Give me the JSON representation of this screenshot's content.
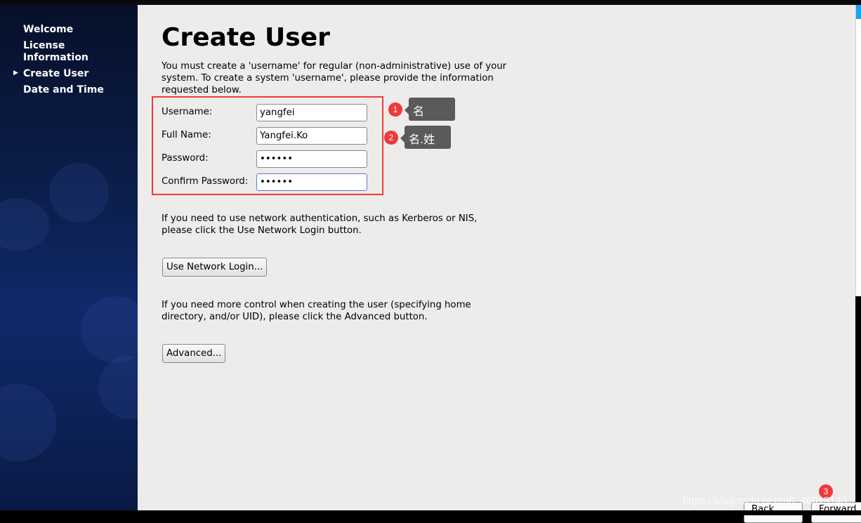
{
  "sidebar": {
    "items": [
      {
        "label": "Welcome"
      },
      {
        "label": "License Information"
      },
      {
        "label": "Create User",
        "current": true
      },
      {
        "label": "Date and Time"
      }
    ]
  },
  "main": {
    "title": "Create User",
    "intro": "You must create a 'username' for regular (non-administrative) use of your system.  To create a system 'username', please provide the information requested below.",
    "fields": [
      {
        "label": "Username:",
        "value": "yangfei"
      },
      {
        "label": "Full Name:",
        "value": "Yangfei.Ko"
      },
      {
        "label": "Password:",
        "value": "••••••"
      },
      {
        "label": "Confirm Password:",
        "value": "••••••"
      }
    ],
    "network_text": "If you need to use network authentication, such as Kerberos or NIS, please click the Use Network Login button.",
    "network_button": "Use Network Login...",
    "advanced_text": "If you need more control when creating the user (specifying home directory, and/or UID), please click the Advanced button.",
    "advanced_button": "Advanced..."
  },
  "annotations": [
    {
      "num": "1",
      "text": "名"
    },
    {
      "num": "2",
      "text": "名.姓"
    },
    {
      "num": "3"
    }
  ],
  "footer": {
    "back": "Back",
    "forward": "Forward"
  },
  "watermark": "https://blog.csdn.net/m0_46015143",
  "colors": {
    "accent_red": "#f03a3a",
    "tooltip": "#5a5a5a",
    "sidebar": "#0c1f4e"
  }
}
